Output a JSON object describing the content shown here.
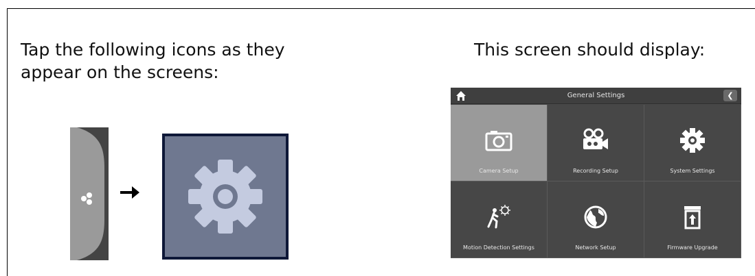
{
  "instructions": {
    "left_line1": "Tap the following icons as they",
    "left_line2": "appear on the screens:",
    "right": "This screen should display:"
  },
  "icons": {
    "side_tab": "menu-dots-icon",
    "arrow": "right-arrow-icon",
    "settings": "gear-icon"
  },
  "screen": {
    "title": "General Settings",
    "back_label": "❮",
    "items": [
      {
        "label": "Camera Setup",
        "icon": "camera-icon",
        "selected": true
      },
      {
        "label": "Recording Setup",
        "icon": "video-camera-icon",
        "selected": false
      },
      {
        "label": "System Settings",
        "icon": "gear-icon",
        "selected": false
      },
      {
        "label": "Motion Detection Settings",
        "icon": "motion-detection-icon",
        "selected": false
      },
      {
        "label": "Network Setup",
        "icon": "globe-icon",
        "selected": false
      },
      {
        "label": "Firmware Upgrade",
        "icon": "firmware-upgrade-icon",
        "selected": false
      }
    ]
  },
  "colors": {
    "gear_tile_bg": "#6f7890",
    "gear_tile_border": "#0e1838",
    "screen_bg": "#474747",
    "selected_cell": "#9a9a9a"
  }
}
